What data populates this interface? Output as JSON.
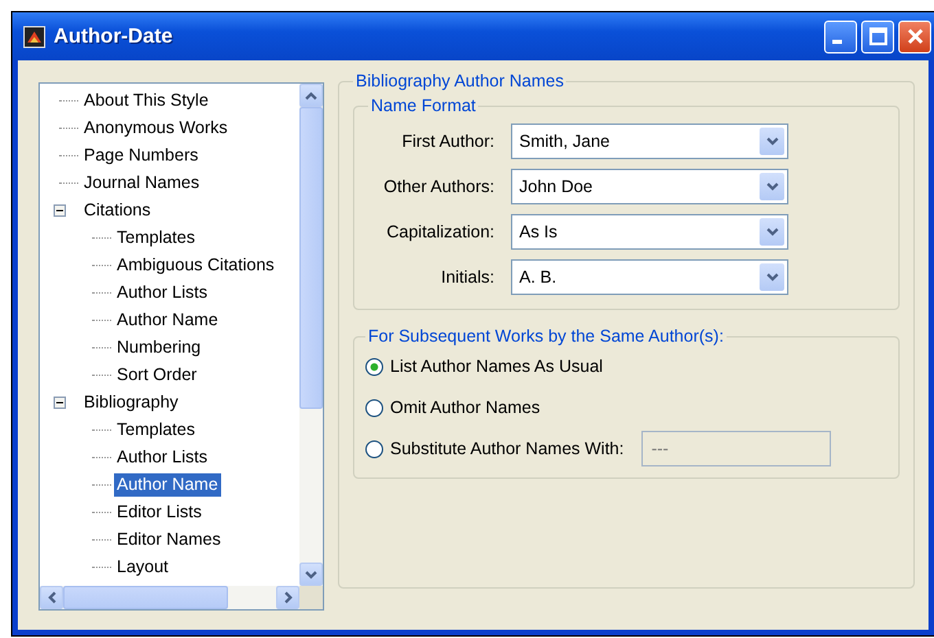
{
  "window": {
    "title": "Author-Date"
  },
  "tree": {
    "items": [
      {
        "label": "About This Style",
        "selected": false
      },
      {
        "label": "Anonymous Works",
        "selected": false
      },
      {
        "label": "Page Numbers",
        "selected": false
      },
      {
        "label": "Journal Names",
        "selected": false
      },
      {
        "label": "Citations",
        "selected": false,
        "expanded": true,
        "children": [
          {
            "label": "Templates",
            "selected": false
          },
          {
            "label": "Ambiguous Citations",
            "selected": false
          },
          {
            "label": "Author Lists",
            "selected": false
          },
          {
            "label": "Author Name",
            "selected": false
          },
          {
            "label": "Numbering",
            "selected": false
          },
          {
            "label": "Sort Order",
            "selected": false
          }
        ]
      },
      {
        "label": "Bibliography",
        "selected": false,
        "expanded": true,
        "children": [
          {
            "label": "Templates",
            "selected": false
          },
          {
            "label": "Author Lists",
            "selected": false
          },
          {
            "label": "Author Name",
            "selected": true
          },
          {
            "label": "Editor Lists",
            "selected": false
          },
          {
            "label": "Editor Names",
            "selected": false
          },
          {
            "label": "Layout",
            "selected": false
          }
        ]
      }
    ]
  },
  "panel": {
    "title": "Bibliography Author Names",
    "name_format": {
      "title": "Name Format",
      "fields": [
        {
          "label": "First Author:",
          "value": "Smith, Jane"
        },
        {
          "label": "Other Authors:",
          "value": "John Doe"
        },
        {
          "label": "Capitalization:",
          "value": "As Is"
        },
        {
          "label": "Initials:",
          "value": "A. B."
        }
      ]
    },
    "subsequent": {
      "title": "For Subsequent Works by the Same Author(s):",
      "options": [
        {
          "label": "List Author Names As Usual",
          "selected": true
        },
        {
          "label": "Omit Author Names",
          "selected": false
        },
        {
          "label": "Substitute Author Names With:",
          "selected": false,
          "field": {
            "placeholder": "---",
            "disabled": true
          }
        }
      ]
    }
  }
}
